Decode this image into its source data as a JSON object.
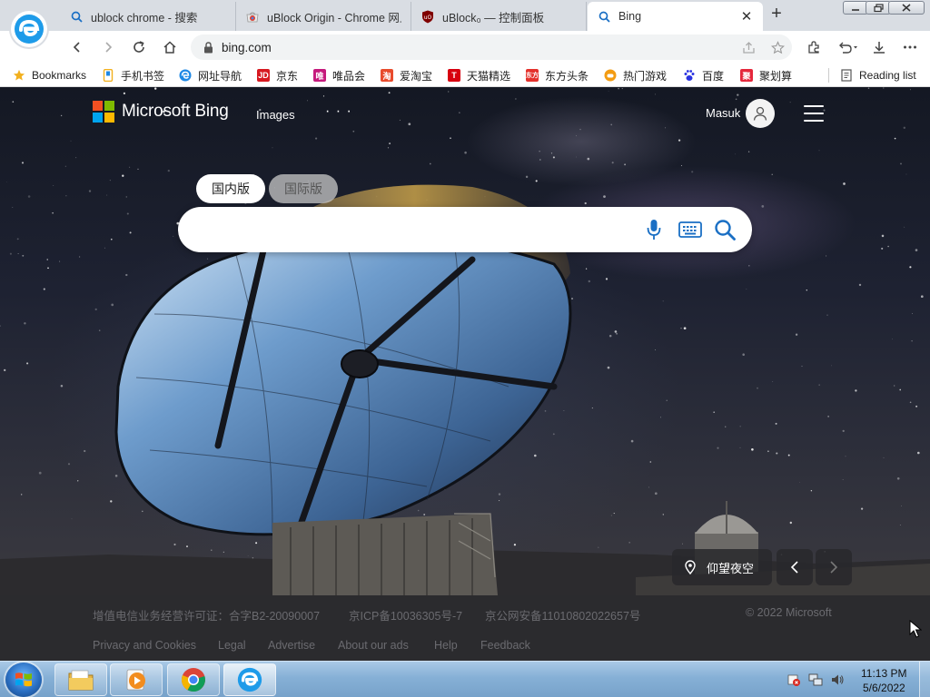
{
  "browser": {
    "tabs": [
      {
        "title": "ublock chrome - 搜索",
        "icon": "search-icon"
      },
      {
        "title": "uBlock Origin - Chrome 网上",
        "icon": "chrome-webstore-icon"
      },
      {
        "title": "uBlock₀ — 控制面板",
        "icon": "ublock-icon"
      },
      {
        "title": "Bing",
        "icon": "search-icon",
        "active": true
      }
    ],
    "address": "bing.com",
    "bookmarks": [
      {
        "label": "Bookmarks",
        "icon": "star-icon",
        "color": "#f2b01e"
      },
      {
        "label": "手机书签",
        "icon": "phone-bookmark-icon",
        "color": "#f2b01e"
      },
      {
        "label": "网址导航",
        "icon": "ie-icon",
        "color": "#1e88e5"
      },
      {
        "label": "京东",
        "icon": "jd-icon",
        "color": "#d71920"
      },
      {
        "label": "唯品会",
        "icon": "vip-icon",
        "color": "#c51a7c"
      },
      {
        "label": "爱淘宝",
        "icon": "taobao-icon",
        "color": "#e84b2c"
      },
      {
        "label": "天猫精选",
        "icon": "tmall-icon",
        "color": "#d7000f"
      },
      {
        "label": "东方头条",
        "icon": "toutiao-icon",
        "color": "#e4312b"
      },
      {
        "label": "热门游戏",
        "icon": "game-icon",
        "color": "#f39c12"
      },
      {
        "label": "百度",
        "icon": "baidu-icon",
        "color": "#2932e1"
      },
      {
        "label": "聚划算",
        "icon": "juhuasuan-icon",
        "color": "#e5273b"
      }
    ],
    "reading_list": "Reading list"
  },
  "bing": {
    "logo_text": "Microsoft Bing",
    "nav_images": "Images",
    "nav_more": "· · ·",
    "user_name": "Masuk",
    "scope_domestic": "国内版",
    "scope_international": "国际版",
    "search_placeholder": "",
    "location_label": "仰望夜空"
  },
  "footer": {
    "license": "增值电信业务经营许可证：合字B2-20090007",
    "icp": "京ICP备10036305号-7",
    "police": "京公网安备11010802022657号",
    "copyright": "© 2022 Microsoft",
    "links": [
      "Privacy and Cookies",
      "Legal",
      "Advertise",
      "About our ads",
      "Help",
      "Feedback"
    ]
  },
  "taskbar": {
    "time": "11:13 PM",
    "date": "5/6/2022"
  },
  "colors": {
    "ms_red": "#f25022",
    "ms_green": "#7fba00",
    "ms_blue": "#00a4ef",
    "ms_yellow": "#ffb900",
    "bing_blue": "#1a6fc4"
  }
}
